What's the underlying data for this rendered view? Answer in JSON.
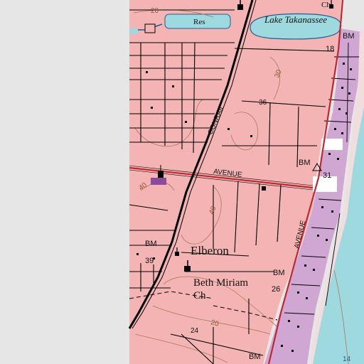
{
  "map": {
    "colors": {
      "background": "#e6e6e6",
      "urban": "#f4b4b4",
      "ocean": "#9fd9e0",
      "beach": "#f0dede",
      "dense_urban": "#d0a6d2",
      "road_red": "#c2262e",
      "road_black": "#000000",
      "contour": "#a87a5a",
      "rail": "#000000"
    },
    "place_labels": {
      "lake": "Lake Takanassee",
      "reservoir": "Res",
      "town": "Elberon",
      "church_1": "Beth Miriam",
      "church_1_b": "Ch",
      "church_top": "Ch"
    },
    "road_labels": {
      "avenue_1": "AVENUE",
      "avenue_2": "AVENUE",
      "rail": "CONRAIL"
    },
    "benchmarks": {
      "bm_1": "BM",
      "bm_2": "BM",
      "bm_3": "BM",
      "bm_4": "BM",
      "bm_5": "BM"
    },
    "elevations": {
      "e_18": "18",
      "e_36": "36",
      "e_31": "31",
      "e_39": "39",
      "e_26": "26",
      "e_24": "24"
    },
    "contour_labels": {
      "c_20_top": "20",
      "c_40_left": "40",
      "c_40_mid": "40",
      "c_20_bottom": "20",
      "c_30": "30",
      "c_14": "14"
    },
    "icons": [
      "school-icon",
      "church-icon",
      "church-icon",
      "church-icon",
      "benchmark-triangle-icon"
    ]
  }
}
